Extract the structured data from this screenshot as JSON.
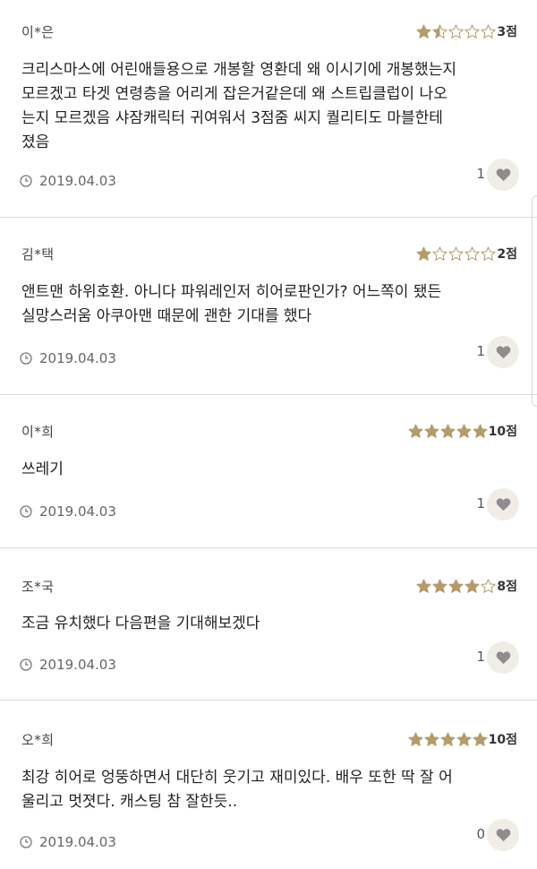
{
  "colors": {
    "star_filled": "#b59b6c",
    "star_empty": "#b59b6c",
    "like_button_bg": "#f0ede6",
    "heart": "#8d8d8d",
    "divider": "#d9d9d9"
  },
  "reviews": [
    {
      "author": "이*은",
      "rating": 1.5,
      "score_label": "3점",
      "text": "크리스마스에 어린애들용으로 개봉할 영환데 왜 이시기에 개봉했는지\n모르겠고 타겟 연령층을 어리게 잡은거같은데 왜 스트립클럽이 나오\n는지 모르겠음 샤잠캐릭터 귀여워서 3점줌 씨지 퀄리티도 마블한테\n졌음",
      "date": "2019.04.03",
      "likes": "1"
    },
    {
      "author": "김*택",
      "rating": 1,
      "score_label": "2점",
      "text": "앤트맨 하위호환. 아니다 파워레인저 히어로판인가? 어느쪽이 됐든\n실망스러움 아쿠아맨 때문에 괜한 기대를 했다",
      "date": "2019.04.03",
      "likes": "1"
    },
    {
      "author": "이*희",
      "rating": 5,
      "score_label": "10점",
      "text": "쓰레기",
      "date": "2019.04.03",
      "likes": "1"
    },
    {
      "author": "조*국",
      "rating": 4,
      "score_label": "8점",
      "text": "조금 유치했다 다음편을 기대해보겠다",
      "date": "2019.04.03",
      "likes": "1"
    },
    {
      "author": "오*희",
      "rating": 5,
      "score_label": "10점",
      "text": "최강 히어로 엉뚱하면서 대단히 웃기고 재미있다. 배우 또한 딱 잘 어\n울리고 멋졋다. 캐스팅 참 잘한듯..",
      "date": "2019.04.03",
      "likes": "0"
    }
  ]
}
